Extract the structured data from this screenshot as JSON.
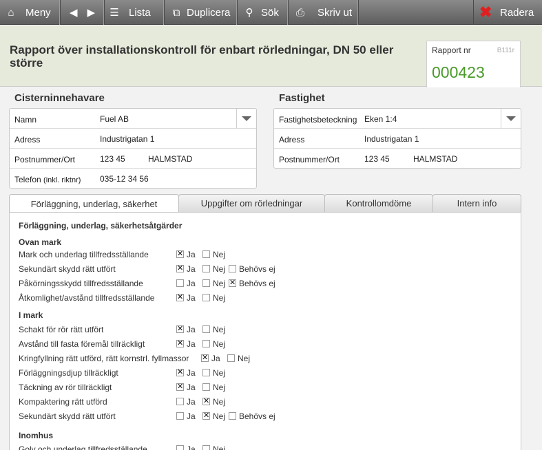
{
  "toolbar": {
    "meny": "Meny",
    "lista": "Lista",
    "duplicera": "Duplicera",
    "sok": "Sök",
    "skriv_ut": "Skriv ut",
    "radera": "Radera"
  },
  "header": {
    "title": "Rapport över installationskontroll för enbart rörledningar, DN 50 eller större",
    "rapport_label": "Rapport nr",
    "form_code": "B111r",
    "rapport_nr": "000423"
  },
  "owner": {
    "title": "Cisterninnehavare",
    "namn_label": "Namn",
    "namn": "Fuel AB",
    "adress_label": "Adress",
    "adress": "Industrigatan 1",
    "post_label": "Postnummer/Ort",
    "postnr": "123 45",
    "ort": "HALMSTAD",
    "tel_label": "Telefon",
    "tel_hint": "(inkl. riktnr)",
    "telefon": "035-12 34 56"
  },
  "property": {
    "title": "Fastighet",
    "bet_label": "Fastighetsbeteckning",
    "bet": "Eken 1:4",
    "adress_label": "Adress",
    "adress": "Industrigatan 1",
    "post_label": "Postnummer/Ort",
    "postnr": "123 45",
    "ort": "HALMSTAD"
  },
  "tabs": [
    "Förläggning, underlag, säkerhet",
    "Uppgifter om rörledningar",
    "Kontrollomdöme",
    "Intern info"
  ],
  "panel": {
    "heading": "Förläggning, underlag, säkerhetsåtgärder",
    "ovan_mark": "Ovan mark",
    "i_mark": "I mark",
    "inomhus": "Inomhus",
    "opt_ja": "Ja",
    "opt_nej": "Nej",
    "opt_behovs": "Behövs ej",
    "q": [
      "Mark och underlag tillfredsställande",
      "Sekundärt skydd rätt utfört",
      "Påkörningsskydd tillfredsställande",
      "Åtkomlighet/avstånd tillfredsställande",
      "Schakt för rör rätt utfört",
      "Avstånd till fasta föremål tillräckligt",
      "Kringfyllning rätt utförd, rätt kornstrl. fyllmassor",
      "Förläggningsdjup tillräckligt",
      "Täckning av rör tillräckligt",
      "Kompaktering rätt utförd",
      "Sekundärt skydd rätt utfört",
      "Golv och underlag tillfredsställande"
    ],
    "answers": [
      "Ja",
      "Ja",
      "Behövs ej",
      "Ja",
      "Ja",
      "Ja",
      "Ja",
      "Ja",
      "Ja",
      "Nej",
      "Nej",
      ""
    ]
  }
}
